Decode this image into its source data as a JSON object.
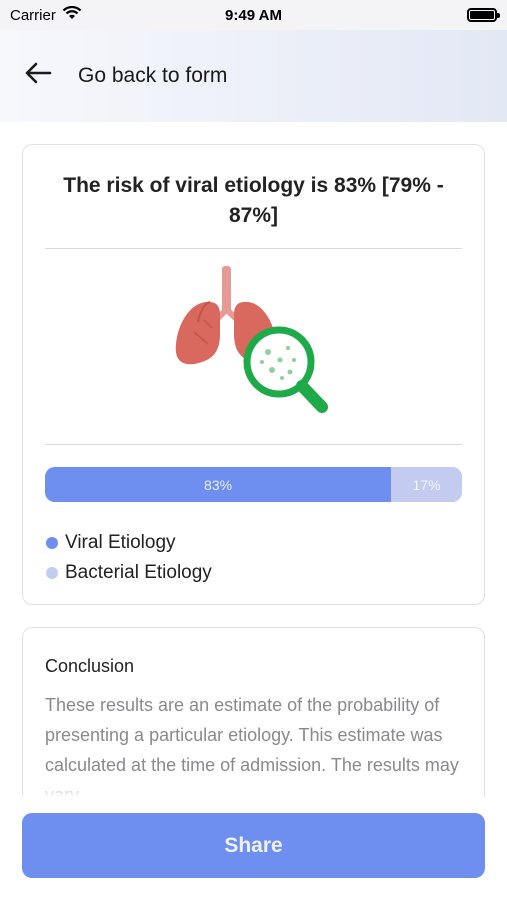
{
  "status_bar": {
    "carrier": "Carrier",
    "time": "9:49 AM"
  },
  "header": {
    "back_label": "Go back to form"
  },
  "result": {
    "title": "The risk of viral etiology is 83% [79% - 87%]",
    "illustration_icon": "lungs-magnifier-icon",
    "viral_percent": 83,
    "bacterial_percent": 17,
    "viral_label": "83%",
    "bacterial_label": "17%",
    "legend": [
      {
        "label": "Viral Etiology",
        "color": "#6f8ff0"
      },
      {
        "label": "Bacterial Etiology",
        "color": "#c3cbf0"
      }
    ]
  },
  "conclusion": {
    "title": "Conclusion",
    "text": "These results are an estimate of the probability of presenting a particular etiology. This estimate was calculated at the time of admission. The results may vary"
  },
  "share": {
    "label": "Share"
  },
  "colors": {
    "accent": "#6f8ff0",
    "accent_light": "#c3cbf0",
    "magnifier": "#1faa4a",
    "lungs": "#d9695f"
  }
}
